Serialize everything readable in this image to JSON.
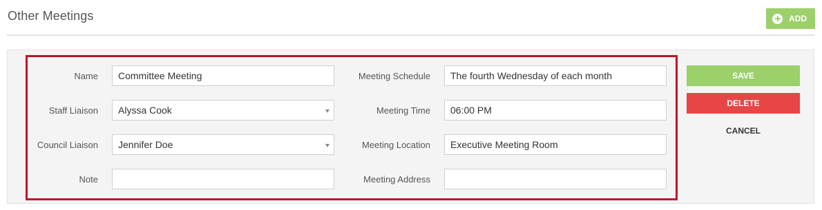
{
  "section": {
    "title": "Other Meetings",
    "add_label": "ADD"
  },
  "form": {
    "name": {
      "label": "Name",
      "value": "Committee Meeting"
    },
    "staff_liaison": {
      "label": "Staff Liaison",
      "value": "Alyssa Cook"
    },
    "council_liaison": {
      "label": "Council Liaison",
      "value": "Jennifer Doe"
    },
    "note": {
      "label": "Note",
      "value": ""
    },
    "meeting_schedule": {
      "label": "Meeting Schedule",
      "value": "The fourth Wednesday of each month"
    },
    "meeting_time": {
      "label": "Meeting Time",
      "value": "06:00 PM"
    },
    "meeting_location": {
      "label": "Meeting Location",
      "value": "Executive Meeting Room"
    },
    "meeting_address": {
      "label": "Meeting Address",
      "value": ""
    }
  },
  "actions": {
    "save_label": "SAVE",
    "delete_label": "DELETE",
    "cancel_label": "CANCEL"
  },
  "colors": {
    "accent_green": "#9cd06b",
    "danger_red": "#e84646",
    "highlight_border": "#c0102a"
  }
}
